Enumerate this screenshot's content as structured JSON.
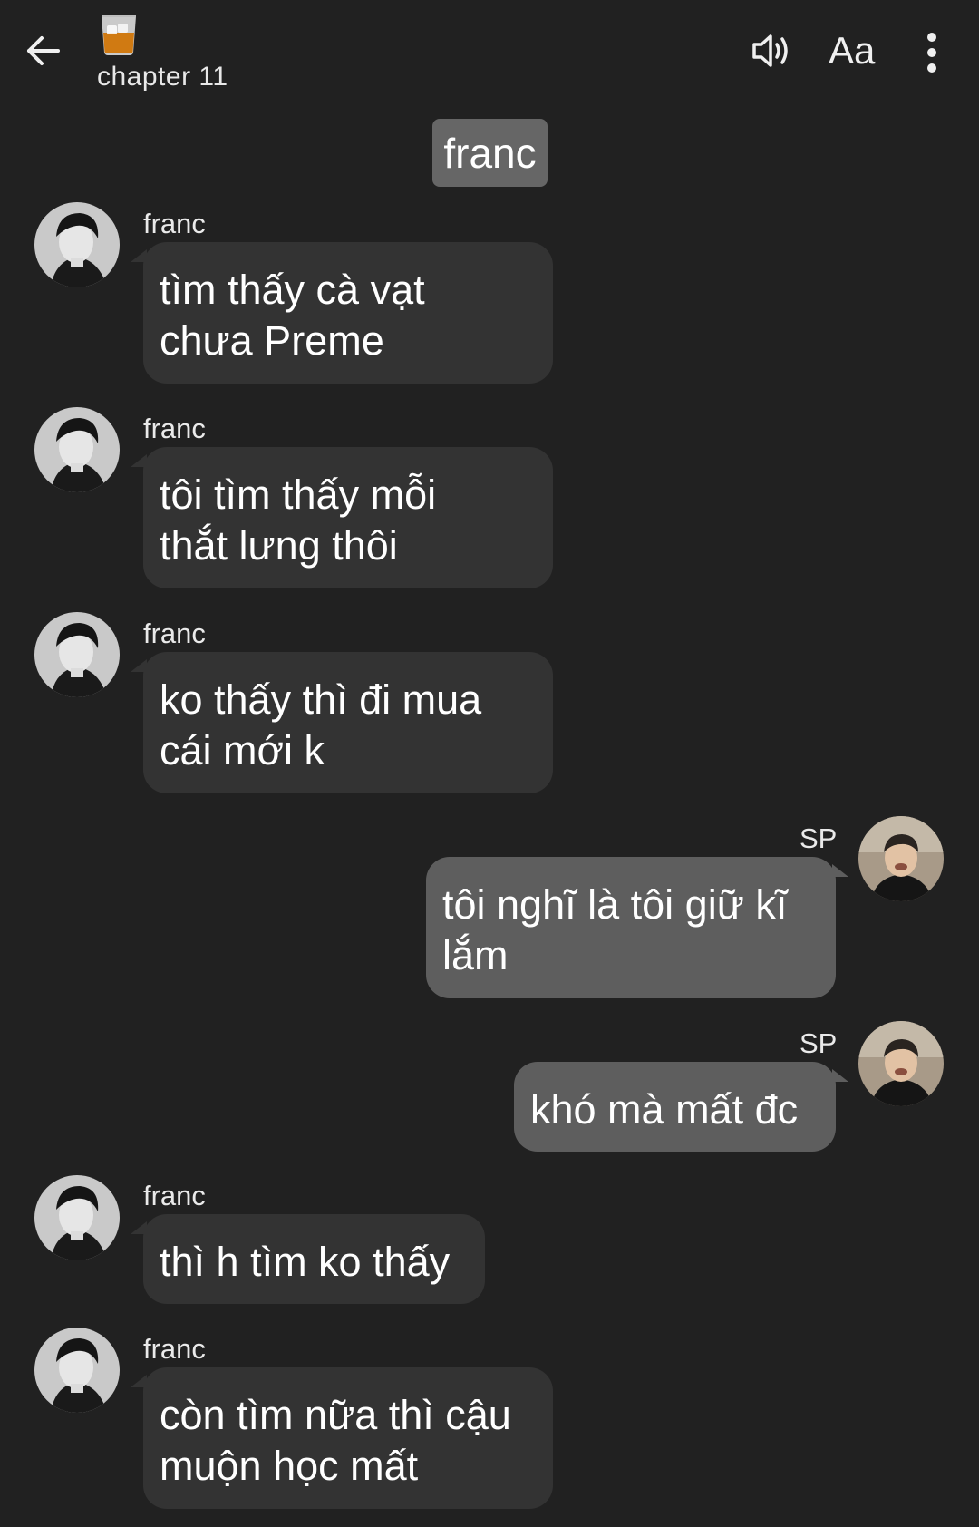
{
  "header": {
    "back_icon": "arrow-left-icon",
    "chat_icon": "whiskey-glass-icon",
    "title": "chapter 11",
    "speaker_icon": "speaker-icon",
    "font_label": "Aa",
    "more_icon": "more-vertical-icon"
  },
  "chapter_chip": "franc",
  "messages": [
    {
      "side": "left",
      "sender": "franc",
      "lines": [
        "tìm thấy cà vạt",
        "chưa Preme"
      ]
    },
    {
      "side": "left",
      "sender": "franc",
      "lines": [
        "tôi tìm thấy mỗi",
        "thắt lưng thôi"
      ]
    },
    {
      "side": "left",
      "sender": "franc",
      "lines": [
        "ko thấy thì đi mua",
        "cái mới k"
      ]
    },
    {
      "side": "right",
      "sender": "SP",
      "lines": [
        "tôi nghĩ là tôi giữ kĩ",
        "lắm"
      ]
    },
    {
      "side": "right",
      "sender": "SP",
      "lines": [
        "khó mà mất đc"
      ]
    },
    {
      "side": "left",
      "sender": "franc",
      "lines": [
        "thì h tìm ko thấy"
      ]
    },
    {
      "side": "left",
      "sender": "franc",
      "lines": [
        "còn tìm nữa thì cậu",
        "muộn học mất"
      ]
    }
  ],
  "colors": {
    "background": "#212121",
    "bubble_left": "#333333",
    "bubble_right": "#5e5e5e",
    "chip": "#666666"
  }
}
